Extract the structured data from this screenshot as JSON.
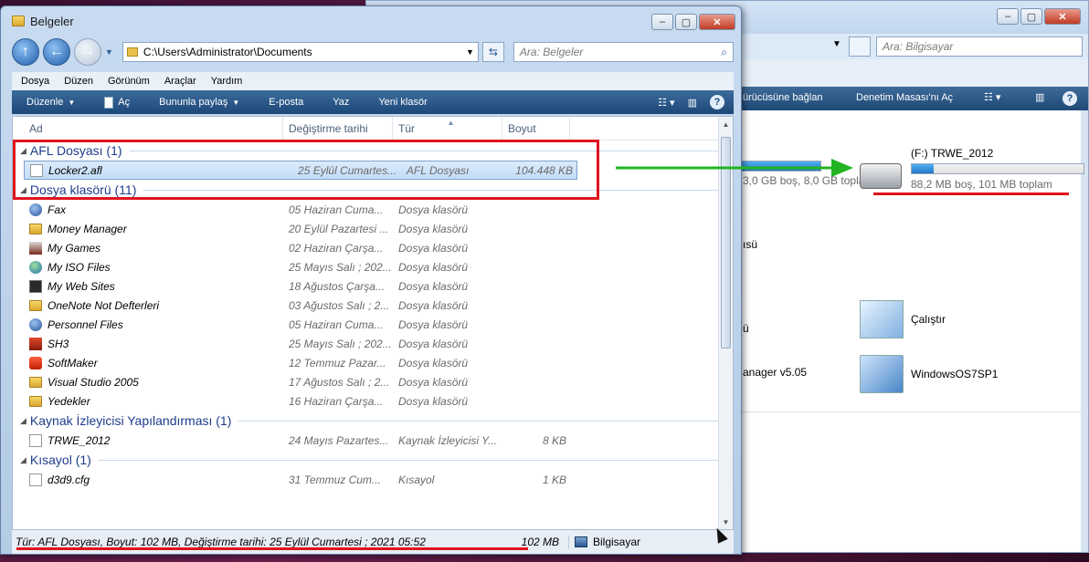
{
  "front_window": {
    "title": "Belgeler",
    "address": "C:\\Users\\Administrator\\Documents",
    "search_placeholder": "Ara: Belgeler",
    "menu": [
      "Dosya",
      "Düzen",
      "Görünüm",
      "Araçlar",
      "Yardım"
    ],
    "toolbar": {
      "organize": "Düzenle",
      "open": "Aç",
      "share": "Bununla paylaş",
      "email": "E-posta",
      "print": "Yaz",
      "new_folder": "Yeni klasör"
    },
    "columns": {
      "name": "Ad",
      "date": "Değiştirme tarihi",
      "type": "Tür",
      "size": "Boyut"
    },
    "groups": [
      {
        "title": "AFL Dosyası (1)",
        "items": [
          {
            "name": "Locker2.afl",
            "date": "25 Eylül Cumartes...",
            "type": "AFL Dosyası",
            "size": "104.448 KB",
            "icon": "doc",
            "selected": true
          }
        ]
      },
      {
        "title": "Dosya klasörü (11)",
        "items": [
          {
            "name": "Fax",
            "date": "05 Haziran Cuma...",
            "type": "Dosya klasörü",
            "size": "",
            "icon": "round"
          },
          {
            "name": "Money Manager",
            "date": "20 Eylül Pazartesi ...",
            "type": "Dosya klasörü",
            "size": "",
            "icon": "folder"
          },
          {
            "name": "My Games",
            "date": "02 Haziran Çarşa...",
            "type": "Dosya klasörü",
            "size": "",
            "icon": "mg"
          },
          {
            "name": "My ISO Files",
            "date": "25 Mayıs Salı ; 202...",
            "type": "Dosya klasörü",
            "size": "",
            "icon": "globe"
          },
          {
            "name": "My Web Sites",
            "date": "18 Ağustos Çarşa...",
            "type": "Dosya klasörü",
            "size": "",
            "icon": "web"
          },
          {
            "name": "OneNote Not Defterleri",
            "date": "03 Ağustos Salı ; 2...",
            "type": "Dosya klasörü",
            "size": "",
            "icon": "folder"
          },
          {
            "name": "Personnel Files",
            "date": "05 Haziran Cuma...",
            "type": "Dosya klasörü",
            "size": "",
            "icon": "round"
          },
          {
            "name": "SH3",
            "date": "25 Mayıs Salı ; 202...",
            "type": "Dosya klasörü",
            "size": "",
            "icon": "red"
          },
          {
            "name": "SoftMaker",
            "date": "12 Temmuz Pazar...",
            "type": "Dosya klasörü",
            "size": "",
            "icon": "sm"
          },
          {
            "name": "Visual Studio 2005",
            "date": "17 Ağustos Salı ; 2...",
            "type": "Dosya klasörü",
            "size": "",
            "icon": "folder"
          },
          {
            "name": "Yedekler",
            "date": "16 Haziran Çarşa...",
            "type": "Dosya klasörü",
            "size": "",
            "icon": "folder"
          }
        ]
      },
      {
        "title": "Kaynak İzleyicisi Yapılandırması (1)",
        "items": [
          {
            "name": "TRWE_2012",
            "date": "24 Mayıs Pazartes...",
            "type": "Kaynak İzleyicisi Y...",
            "size": "8 KB",
            "icon": "doc"
          }
        ]
      },
      {
        "title": "Kısayol (1)",
        "items": [
          {
            "name": "d3d9.cfg",
            "date": "31 Temmuz Cum...",
            "type": "Kısayol",
            "size": "1 KB",
            "icon": "cfg"
          }
        ]
      }
    ],
    "status": {
      "details": "Tür: AFL Dosyası, Boyut: 102 MB, Değiştirme tarihi: 25 Eylül Cumartesi ; 2021 05:52",
      "size": "102 MB",
      "location": "Bilgisayar"
    }
  },
  "back_window": {
    "search_placeholder": "Ara: Bilgisayar",
    "toolbar": {
      "map_drive": "ürücüsüne bağlan",
      "control_panel": "Denetim Masası'nı Aç"
    },
    "drive_left_free": "3,0 GB boş, 8,0 GB toplam",
    "drive": {
      "name": "(F:) TRWE_2012",
      "free": "88,2 MB boş, 101 MB toplam",
      "used_fraction": 0.13
    },
    "left_label_1": "ısü",
    "left_label_2": "ü",
    "left_label_3": "anager v5.05",
    "items": [
      {
        "label": "Çalıştır",
        "icon": "run"
      },
      {
        "label": "WindowsOS7SP1",
        "icon": "win"
      }
    ]
  }
}
